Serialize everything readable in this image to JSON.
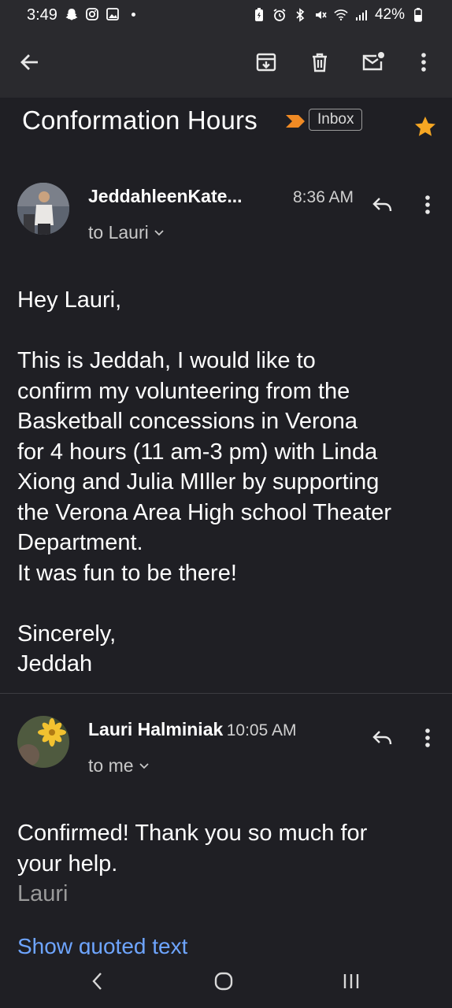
{
  "status_bar": {
    "time": "3:49",
    "battery_percent": "42%"
  },
  "toolbar": {
    "back": "back",
    "archive": "archive",
    "delete": "delete",
    "mark_unread": "mark-unread",
    "more": "more"
  },
  "thread": {
    "subject": "Conformation Hours",
    "label": "Inbox",
    "starred": true
  },
  "messages": [
    {
      "sender": "JeddahleenKate...",
      "time": "8:36 AM",
      "recipient": "to Lauri",
      "body": [
        "Hey Lauri,",
        "This is Jeddah, I would like to",
        "confirm my volunteering from the",
        "Basketball concessions in Verona",
        "for 4 hours (11 am-3 pm) with Linda",
        "Xiong and Julia MIller by supporting",
        "the Verona Area High school Theater",
        "Department.",
        "It was fun to be there!",
        "Sincerely,",
        "Jeddah"
      ]
    },
    {
      "sender": "Lauri Halminiak",
      "time": "10:05 AM",
      "recipient": "to me",
      "body": [
        "Confirmed! Thank you so much for",
        "your help."
      ],
      "signature": "Lauri",
      "show_quoted": "Show quoted text"
    }
  ],
  "colors": {
    "background": "#1f1f24",
    "toolbar": "#2a2a2e",
    "star": "#f5a623",
    "label_arrow": "#f08a24",
    "link": "#6ea5ff"
  }
}
